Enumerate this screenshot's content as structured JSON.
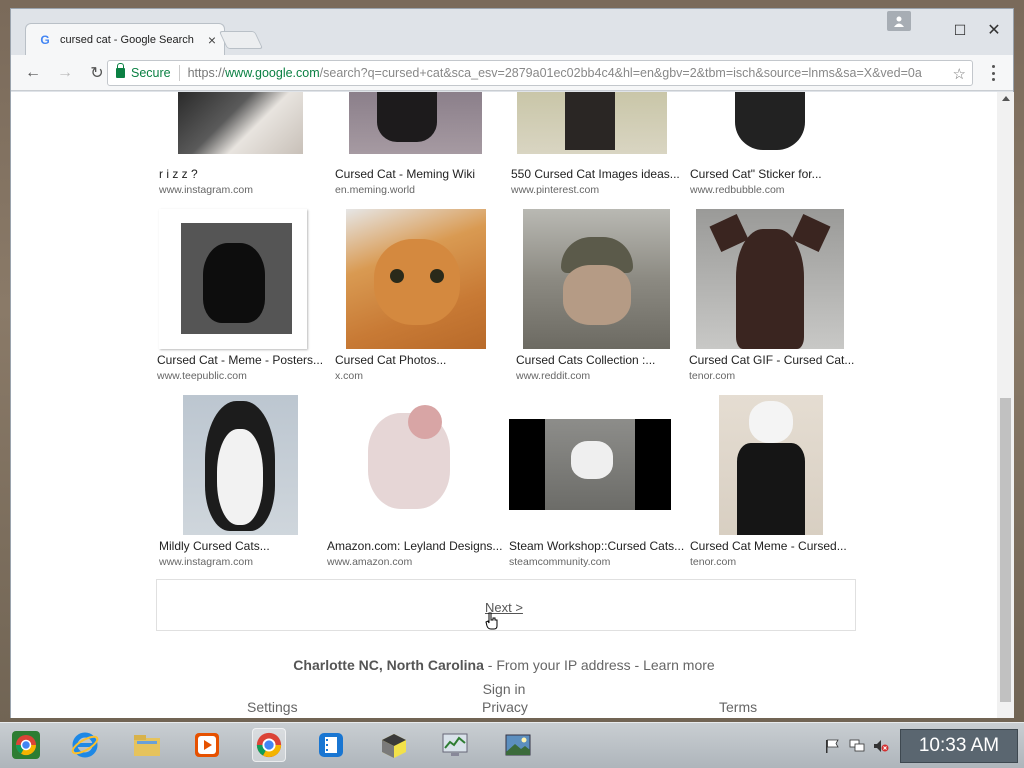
{
  "browser": {
    "tab_title": "cursed cat - Google Search",
    "tab_close": "×",
    "secure_label": "Secure",
    "url_scheme": "https://",
    "url_host": "www.google.com",
    "url_path": "/search?q=cursed+cat&sca_esv=2879a01ec02bb4c4&hl=en&gbv=2&tbm=isch&source=lnms&sa=X&ved=0a",
    "star": "☆",
    "back": "←",
    "forward": "→",
    "reload": "↻",
    "win_minimize": "–",
    "win_maximize": "☐",
    "win_close": "✕"
  },
  "results": [
    {
      "caption": "r i z z ?",
      "source": "www.instagram.com"
    },
    {
      "caption": "Cursed Cat - Meming Wiki",
      "source": "en.meming.world"
    },
    {
      "caption": "550 Cursed Cat Images ideas...",
      "source": "www.pinterest.com"
    },
    {
      "caption": "Cursed Cat\" Sticker for...",
      "source": "www.redbubble.com"
    },
    {
      "caption": "Cursed Cat - Meme - Posters...",
      "source": "www.teepublic.com"
    },
    {
      "caption": "Cursed Cat Photos...",
      "source": "x.com"
    },
    {
      "caption": "Cursed Cats Collection :...",
      "source": "www.reddit.com"
    },
    {
      "caption": "Cursed Cat GIF - Cursed Cat...",
      "source": "tenor.com"
    },
    {
      "caption": "Mildly Cursed Cats...",
      "source": "www.instagram.com"
    },
    {
      "caption": "Amazon.com: Leyland Designs...",
      "source": "www.amazon.com"
    },
    {
      "caption": "Steam Workshop::Cursed Cats...",
      "source": "steamcommunity.com"
    },
    {
      "caption": "Cursed Cat Meme - Cursed...",
      "source": "tenor.com"
    }
  ],
  "pagination": {
    "next_label": "Next >"
  },
  "footer": {
    "location_bold": "Charlotte NC, North Carolina",
    "location_rest": " - From your IP address - ",
    "learn_more": "Learn more",
    "sign_in": "Sign in",
    "settings": "Settings",
    "privacy": "Privacy",
    "terms": "Terms"
  },
  "taskbar": {
    "clock": "10:33 AM",
    "apps": [
      "chrome-os-icon",
      "internet-explorer-icon",
      "file-explorer-icon",
      "media-player-icon",
      "chrome-icon",
      "video-editor-icon",
      "app-icon",
      "monitor-icon",
      "photo-viewer-icon"
    ]
  }
}
